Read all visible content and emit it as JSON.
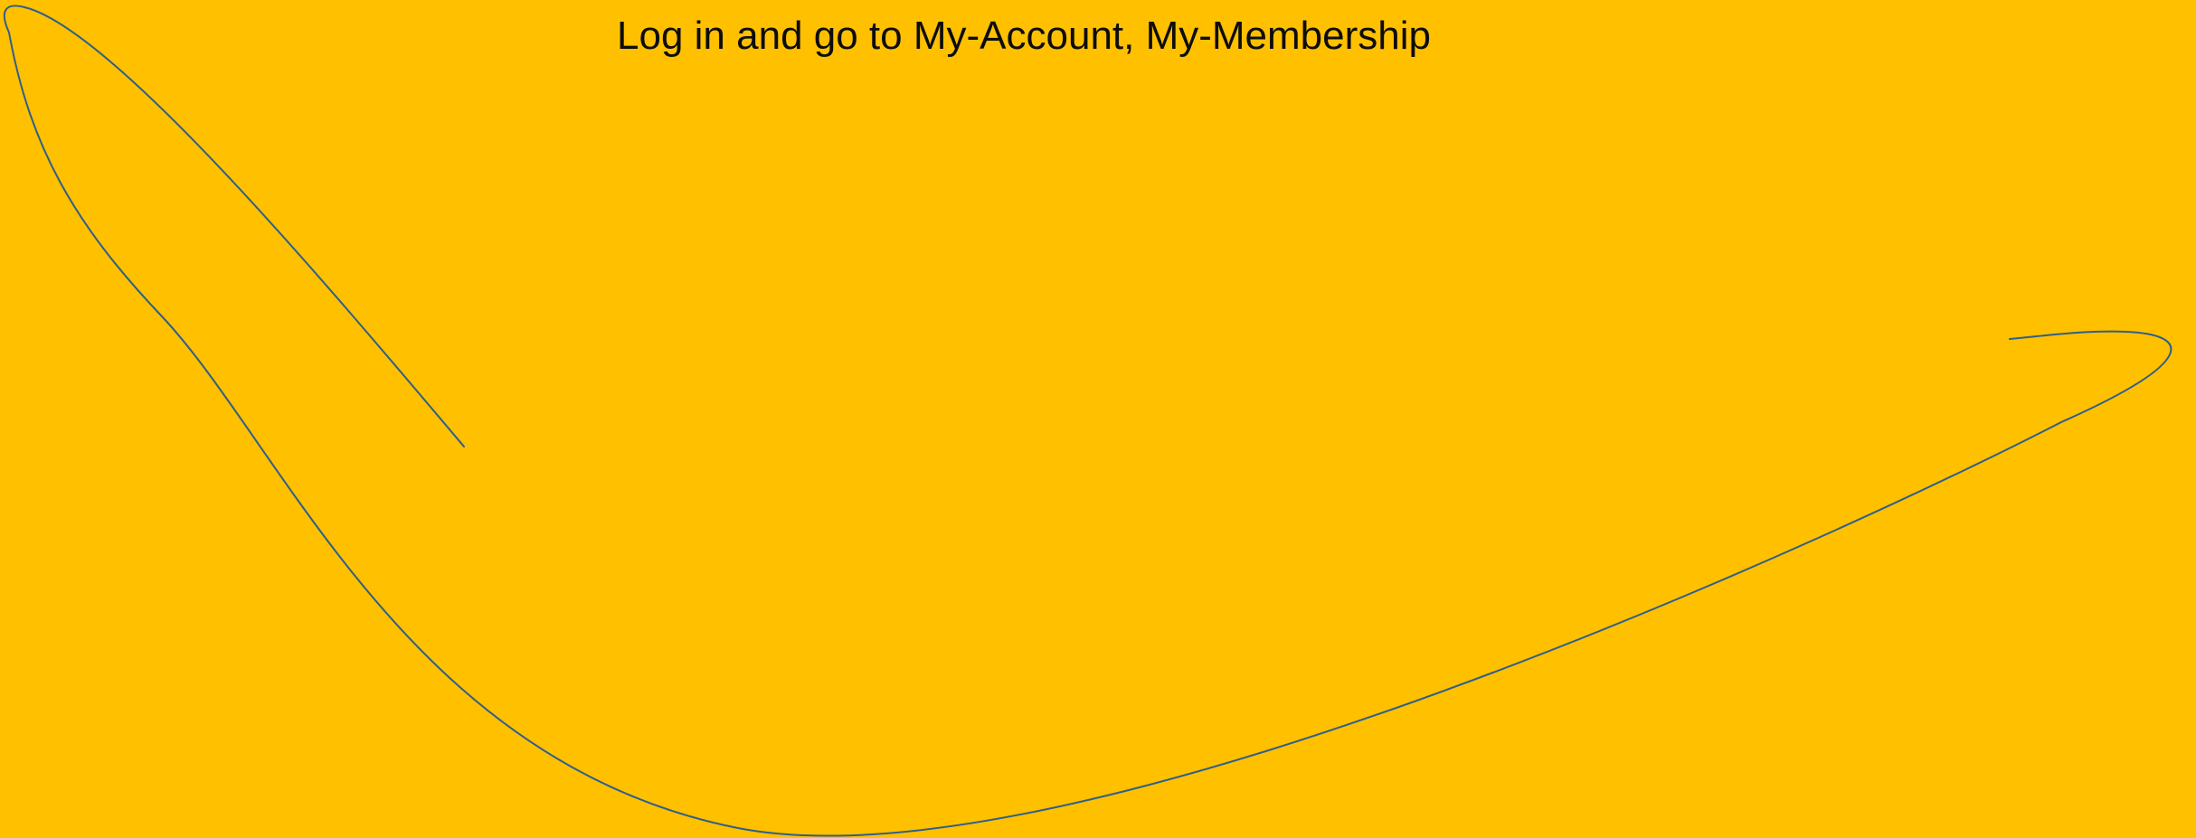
{
  "slide": {
    "background_color": "#FFC000",
    "text_color": "#0d0d0d",
    "accent_line_color": "#2E5F8A",
    "partial_top_text": "",
    "instruction_text": "Log in and go to My-Account, My-Membership"
  }
}
